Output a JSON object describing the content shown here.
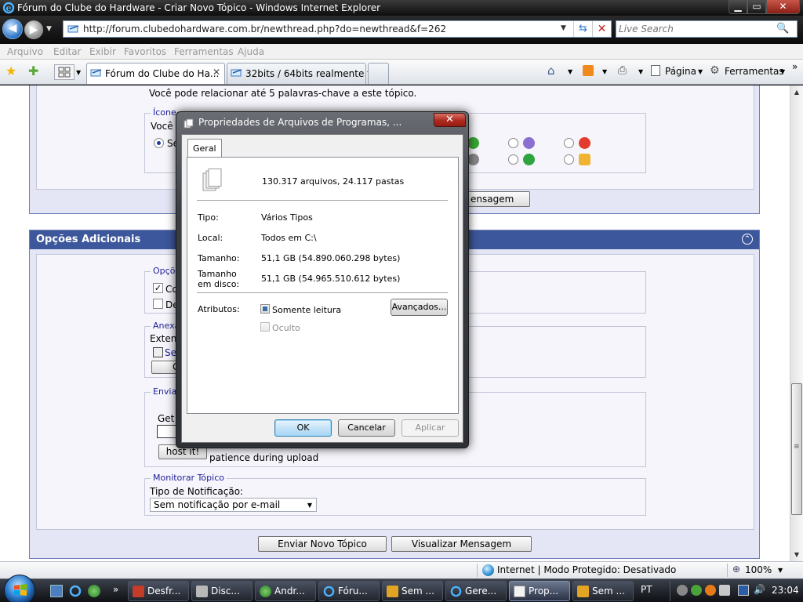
{
  "window": {
    "title": "Fórum do Clube do Hardware - Criar Novo Tópico - Windows Internet Explorer",
    "minimize": "▁",
    "maximize": "▭",
    "close": "✕"
  },
  "address": {
    "url": "http://forum.clubedohardware.com.br/newthread.php?do=newthread&f=262",
    "search_placeholder": "Live Search"
  },
  "menu": [
    "Arquivo",
    "Editar",
    "Exibir",
    "Favoritos",
    "Ferramentas",
    "Ajuda"
  ],
  "tabs": [
    {
      "label": "Fórum do Clube do Ha...",
      "active": true,
      "close": "✕"
    },
    {
      "label": "32bits / 64bits realmente t...",
      "active": false
    }
  ],
  "commands": {
    "page": "Página",
    "tools": "Ferramentas",
    "more": "»"
  },
  "page": {
    "keywords_hint": "Você pode relacionar até 5 palavras-chave a este tópico.",
    "icons_legend": "Ícone",
    "icons_hint": "Você",
    "icons_radio_label": "Se",
    "preview_button_fragment": "ensagem",
    "options_panel_title": "Opções Adicionais",
    "options_legend": "Opçõ",
    "options_chk1_label": "Co",
    "options_chk2_label": "De",
    "attach_legend": "Anexa",
    "attach_ext": "Exten",
    "attach_link": "Se",
    "attach_btn_fragment": "G",
    "send_legend": "Envia",
    "send_get": "Get",
    "host_button": "host it!",
    "patience_text": "patience during upload",
    "monitor_legend": "Monitorar Tópico",
    "notification_label": "Tipo de Notificação:",
    "notification_value": "Sem notificação por e-mail",
    "submit_button": "Enviar Novo Tópico",
    "preview_button": "Visualizar Mensagem"
  },
  "dialog": {
    "title": "Propriedades de Arquivos de Programas, ...",
    "close": "✕",
    "tab": "Geral",
    "summary": "130.317 arquivos, 24.117 pastas",
    "rows": [
      {
        "label": "Tipo:",
        "value": "Vários Tipos"
      },
      {
        "label": "Local:",
        "value": "Todos em C:\\"
      },
      {
        "label": "Tamanho:",
        "value": "51,1 GB (54.890.060.298 bytes)"
      },
      {
        "label": "Tamanho\nem disco:",
        "value": "51,1 GB (54.965.510.612 bytes)"
      }
    ],
    "attributes_label": "Atributos:",
    "readonly_label": "Somente leitura",
    "hidden_label": "Oculto",
    "advanced_button": "Avançados...",
    "ok": "OK",
    "cancel": "Cancelar",
    "apply": "Aplicar"
  },
  "status": {
    "zone": "Internet | Modo Protegido: Desativado",
    "zoom": "100%"
  },
  "taskbar": {
    "tasks": [
      {
        "label": "Desfr...",
        "icon": "defrag-icon",
        "active": false
      },
      {
        "label": "Disc...",
        "icon": "disk-cleanup-icon",
        "active": false
      },
      {
        "label": "Andr...",
        "icon": "messenger-icon",
        "active": false
      },
      {
        "label": "Fóru...",
        "icon": "ie-icon",
        "active": false
      },
      {
        "label": "Sem ...",
        "icon": "winamp-icon",
        "active": false
      },
      {
        "label": "Gere...",
        "icon": "ie-icon",
        "active": false
      },
      {
        "label": "Prop...",
        "icon": "properties-icon",
        "active": true
      },
      {
        "label": "Sem ...",
        "icon": "winamp-icon",
        "active": false
      }
    ],
    "lang": "PT",
    "clock": "23:04",
    "more": "»"
  },
  "colors": {
    "panel_header": "#3d579c",
    "panel_bg": "#e4e6f6",
    "legend_text": "#22229c",
    "dialog_frame": "#2d3035",
    "dialog_close": "#b02a1e"
  }
}
